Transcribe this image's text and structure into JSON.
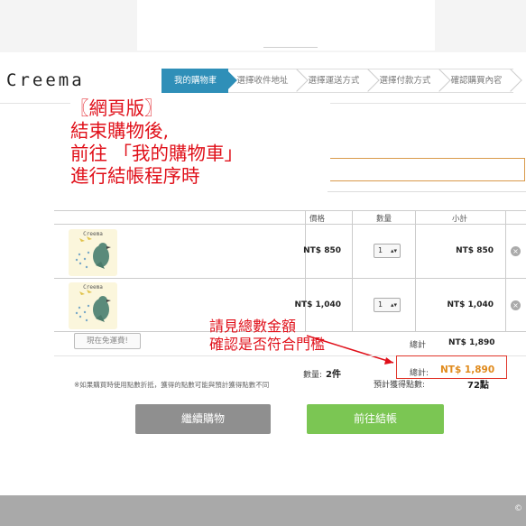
{
  "app": {
    "logo": "Creema"
  },
  "steps": [
    "我的購物車",
    "選擇收件地址",
    "選擇運送方式",
    "選擇付款方式",
    "確認購買內容"
  ],
  "annotation_top": [
    "〖網頁版〗",
    "結束購物後,",
    "前往 「我的購物車」",
    "進行結帳程序時"
  ],
  "annotation_total": [
    "請見總數金額",
    "確認是否符合門檻"
  ],
  "cart": {
    "headers": {
      "price": "價格",
      "qty": "數量",
      "subtotal": "小計"
    },
    "items": [
      {
        "thumb_text": "Creema",
        "price": "NT$ 850",
        "qty": "1",
        "subtotal": "NT$ 850"
      },
      {
        "thumb_text": "Creema",
        "price": "NT$ 1,040",
        "qty": "1",
        "subtotal": "NT$ 1,040"
      }
    ]
  },
  "free_shipping_label": "現在免運費!",
  "subtotal_label": "總計",
  "subtotal_value": "NT$ 1,890",
  "quantity_label": "數量:",
  "quantity_value": "2件",
  "total_label": "總計:",
  "total_value": "NT$ 1,890",
  "points_note": "※如果購買時使用點數折抵，獲得的點數可能與預計獲得點數不同",
  "points_label": "預計獲得點數:",
  "points_value": "72點",
  "buttons": {
    "continue": "繼續購物",
    "checkout": "前往結帳"
  },
  "footer_text": "©"
}
